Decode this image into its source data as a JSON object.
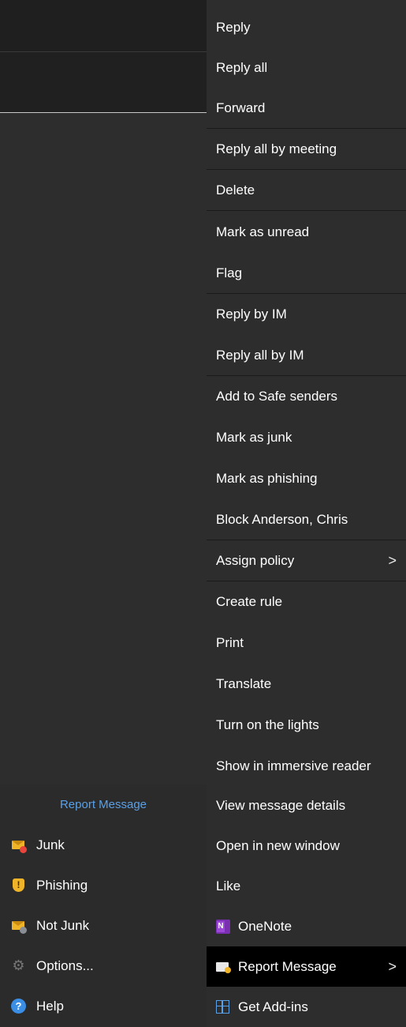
{
  "menu": {
    "items": [
      {
        "label": "Reply"
      },
      {
        "label": "Reply all"
      },
      {
        "label": "Forward"
      },
      {
        "label": "Reply all by meeting"
      },
      {
        "label": "Delete"
      },
      {
        "label": "Mark as unread"
      },
      {
        "label": "Flag"
      },
      {
        "label": "Reply by IM"
      },
      {
        "label": "Reply all by IM"
      },
      {
        "label": "Add to Safe senders"
      },
      {
        "label": "Mark as junk"
      },
      {
        "label": "Mark as phishing"
      },
      {
        "label": "Block Anderson, Chris"
      },
      {
        "label": "Assign policy",
        "submenu": true
      },
      {
        "label": "Create rule"
      },
      {
        "label": "Print"
      },
      {
        "label": "Translate"
      },
      {
        "label": "Turn on the lights"
      },
      {
        "label": "Show in immersive reader"
      },
      {
        "label": "View message details"
      },
      {
        "label": "Open in new window"
      },
      {
        "label": "Like"
      },
      {
        "label": "OneNote",
        "icon": "onenote-icon"
      },
      {
        "label": "Report Message",
        "icon": "report-message-icon",
        "submenu": true,
        "highlighted": true
      },
      {
        "label": "Get Add-ins",
        "icon": "add-ins-icon"
      }
    ],
    "chevron": ">"
  },
  "report_submenu": {
    "title": "Report Message",
    "items": [
      {
        "label": "Junk",
        "icon": "junk-icon"
      },
      {
        "label": "Phishing",
        "icon": "phishing-shield-icon",
        "glyph": "!"
      },
      {
        "label": "Not Junk",
        "icon": "not-junk-icon"
      },
      {
        "label": "Options...",
        "icon": "gear-icon",
        "glyph": "⚙"
      },
      {
        "label": "Help",
        "icon": "help-icon",
        "glyph": "?"
      }
    ]
  },
  "colors": {
    "menu_bg": "#2d2d2d",
    "highlight_bg": "#000000",
    "accent_blue": "#5aa0e6",
    "icon_yellow": "#f0b429"
  }
}
